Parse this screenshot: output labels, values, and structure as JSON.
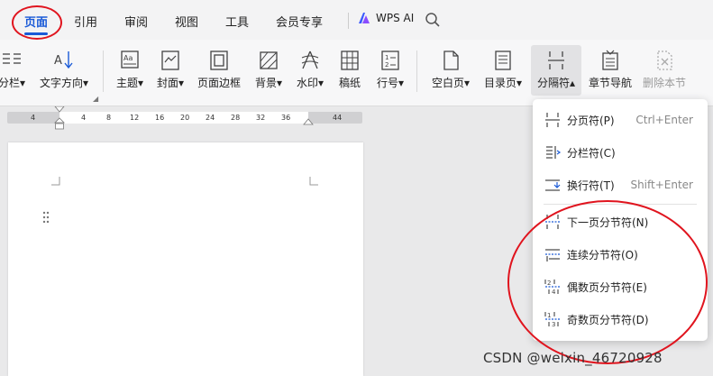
{
  "tabs": [
    {
      "label": "页面",
      "active": true
    },
    {
      "label": "引用"
    },
    {
      "label": "审阅"
    },
    {
      "label": "视图"
    },
    {
      "label": "工具"
    },
    {
      "label": "会员专享"
    }
  ],
  "wps_ai": {
    "label": "WPS AI",
    "icon": "wps-ai-logo-icon"
  },
  "ribbon": {
    "columns": "分栏",
    "text_direction": "文字方向",
    "theme": "主题",
    "cover": "封面",
    "page_border": "页面边框",
    "background": "背景",
    "watermark": "水印",
    "manuscript": "稿纸",
    "line_number": "行号",
    "blank_page": "空白页",
    "toc_page": "目录页",
    "separator": "分隔符",
    "section_nav": "章节导航",
    "delete_section": "删除本节"
  },
  "ruler": {
    "numbers": [
      "4",
      "4",
      "8",
      "12",
      "16",
      "20",
      "24",
      "28",
      "32",
      "36",
      "44"
    ]
  },
  "separator_menu": {
    "items": [
      {
        "label": "分页符(P)",
        "shortcut": "Ctrl+Enter",
        "icon": "page-break-icon"
      },
      {
        "label": "分栏符(C)",
        "shortcut": "",
        "icon": "column-break-icon"
      },
      {
        "label": "换行符(T)",
        "shortcut": "Shift+Enter",
        "icon": "line-break-icon"
      },
      {
        "label": "下一页分节符(N)",
        "shortcut": "",
        "icon": "next-page-section-icon"
      },
      {
        "label": "连续分节符(O)",
        "shortcut": "",
        "icon": "continuous-section-icon"
      },
      {
        "label": "偶数页分节符(E)",
        "shortcut": "",
        "icon": "even-page-section-icon"
      },
      {
        "label": "奇数页分节符(D)",
        "shortcut": "",
        "icon": "odd-page-section-icon"
      }
    ]
  },
  "watermark_text": "CSDN @weixin_46720928",
  "colors": {
    "accent": "#1a5ad7",
    "annotation": "#e0141e"
  }
}
